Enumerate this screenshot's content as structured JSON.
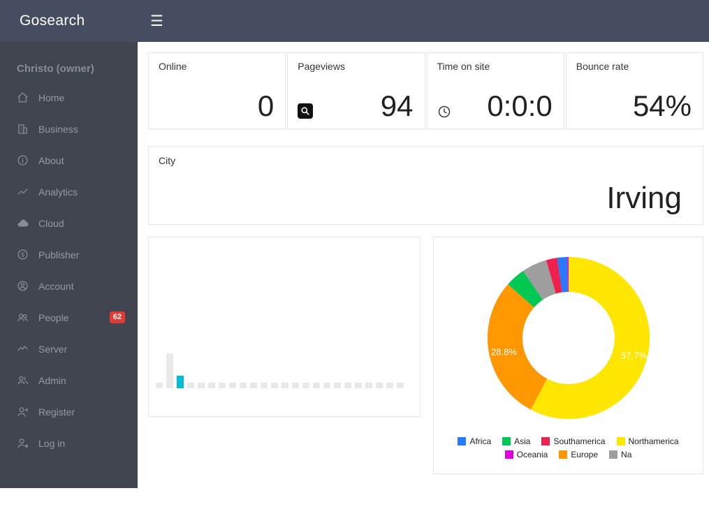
{
  "navbar": {
    "brand": "Gosearch"
  },
  "sidebar": {
    "owner": "Christo (owner)",
    "items": [
      {
        "label": "Home"
      },
      {
        "label": "Business"
      },
      {
        "label": "About"
      },
      {
        "label": "Analytics"
      },
      {
        "label": "Cloud"
      },
      {
        "label": "Publisher"
      },
      {
        "label": "Account"
      },
      {
        "label": "People",
        "badge": "62"
      },
      {
        "label": "Server"
      },
      {
        "label": "Admin"
      },
      {
        "label": "Register"
      },
      {
        "label": "Log in"
      }
    ]
  },
  "stats": [
    {
      "label": "Online",
      "value": "0"
    },
    {
      "label": "Pageviews",
      "value": "94",
      "icon": "search-icon"
    },
    {
      "label": "Time on site",
      "value": "0:0:0",
      "icon": "clock-icon"
    },
    {
      "label": "Bounce rate",
      "value": "54%"
    }
  ],
  "city_card": {
    "label": "City",
    "value": "Irving"
  },
  "chart_data": [
    {
      "type": "bar",
      "values": [
        8,
        50,
        18,
        8,
        8,
        8,
        8,
        8,
        8,
        8,
        8,
        8,
        8,
        8,
        8,
        8,
        8,
        8,
        8,
        8,
        8,
        8,
        8,
        8
      ],
      "highlight_index": 2,
      "bar_color": "#e9e9e9",
      "highlight_color": "#00bcd4"
    },
    {
      "type": "pie",
      "series": [
        {
          "name": "Africa",
          "value": 2.0,
          "color": "#2979ff"
        },
        {
          "name": "Asia",
          "value": 4.0,
          "color": "#00c853"
        },
        {
          "name": "Southamerica",
          "value": 2.2,
          "color": "#ee204d"
        },
        {
          "name": "Northamerica",
          "value": 57.7,
          "color": "#ffe600"
        },
        {
          "name": "Oceania",
          "value": 0.3,
          "color": "#e100e1"
        },
        {
          "name": "Europe",
          "value": 28.8,
          "color": "#ff9800"
        },
        {
          "name": "Na",
          "value": 5.0,
          "color": "#9e9e9e"
        }
      ],
      "draw_order": [
        "Northamerica",
        "Europe",
        "Asia",
        "Na",
        "Southamerica",
        "Africa",
        "Oceania"
      ],
      "labels": {
        "left": "28.8%",
        "right": "57.7%"
      },
      "legend_rows": [
        4,
        3
      ]
    }
  ]
}
